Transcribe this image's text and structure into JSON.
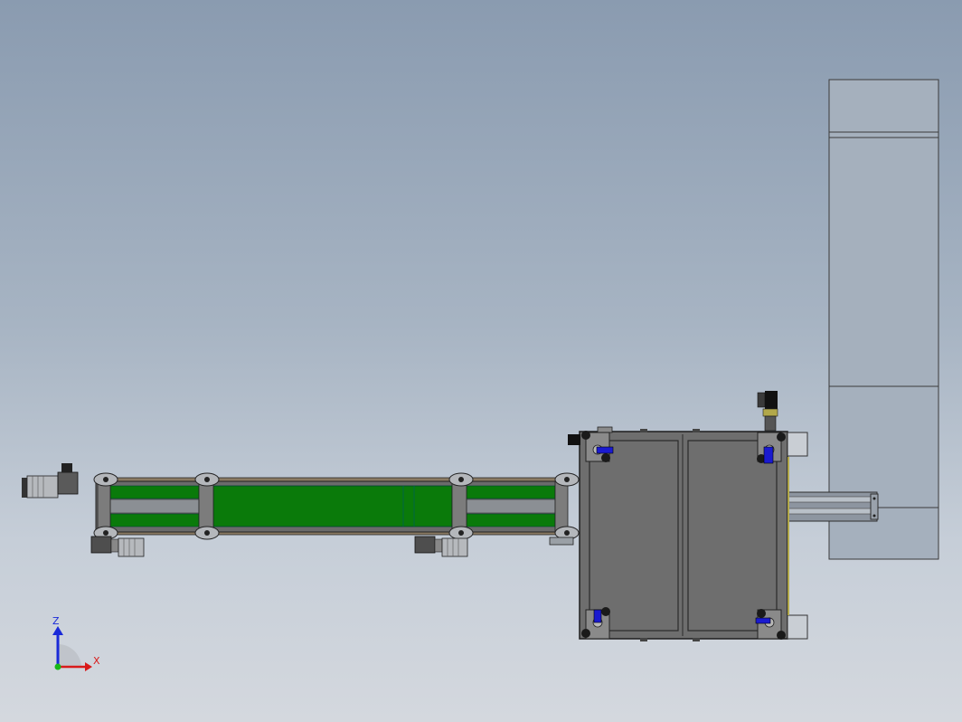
{
  "viewport": {
    "background_top": "#8a9bb0",
    "background_bottom": "#d4d8de"
  },
  "model": {
    "conveyor_belt_color": "#0a7a0a",
    "frame_color": "#6b6b6b",
    "cabinet_color": "#6e6e6e",
    "cylinder_color": "#1a1ad0",
    "tall_column_color": "#a5b0bd"
  },
  "triad": {
    "z_label": "Z",
    "x_label": "X",
    "z_color": "#1a2ad8",
    "x_color": "#d81a1a",
    "y_color": "#18b818"
  }
}
